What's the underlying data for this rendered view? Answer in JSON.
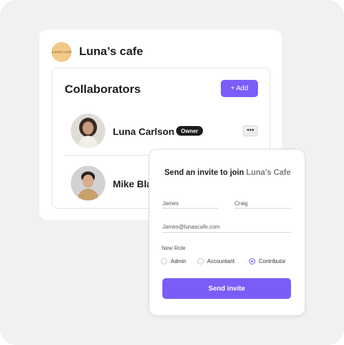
{
  "brand": {
    "logo_text": "Luna's cafe",
    "name": "Luna’s cafe"
  },
  "collaborators": {
    "title": "Collaborators",
    "add_label": "+ Add",
    "people": [
      {
        "name": "Luna Carlson",
        "badge": "Owner",
        "more_label": "•••"
      },
      {
        "name": "Mike Bla"
      }
    ]
  },
  "invite": {
    "title_prefix": "Send an invite to join ",
    "title_highlight": "Luna's Cafe",
    "first_name": "James",
    "last_name": "Craig",
    "email": "James@lunascafe.com",
    "role_label": "New Role",
    "roles": [
      {
        "label": "Admin",
        "selected": false
      },
      {
        "label": "Accountant",
        "selected": false
      },
      {
        "label": "Contributor",
        "selected": true
      }
    ],
    "submit_label": "Send invite"
  },
  "colors": {
    "accent": "#7b5cf6",
    "background": "#f1f1f1",
    "badge": "#1d1d1f",
    "logo_bg": "#f3c98a"
  },
  "icons": {
    "more": "more-horizontal-icon",
    "avatar_1": "avatar-photo",
    "avatar_2": "avatar-photo"
  }
}
